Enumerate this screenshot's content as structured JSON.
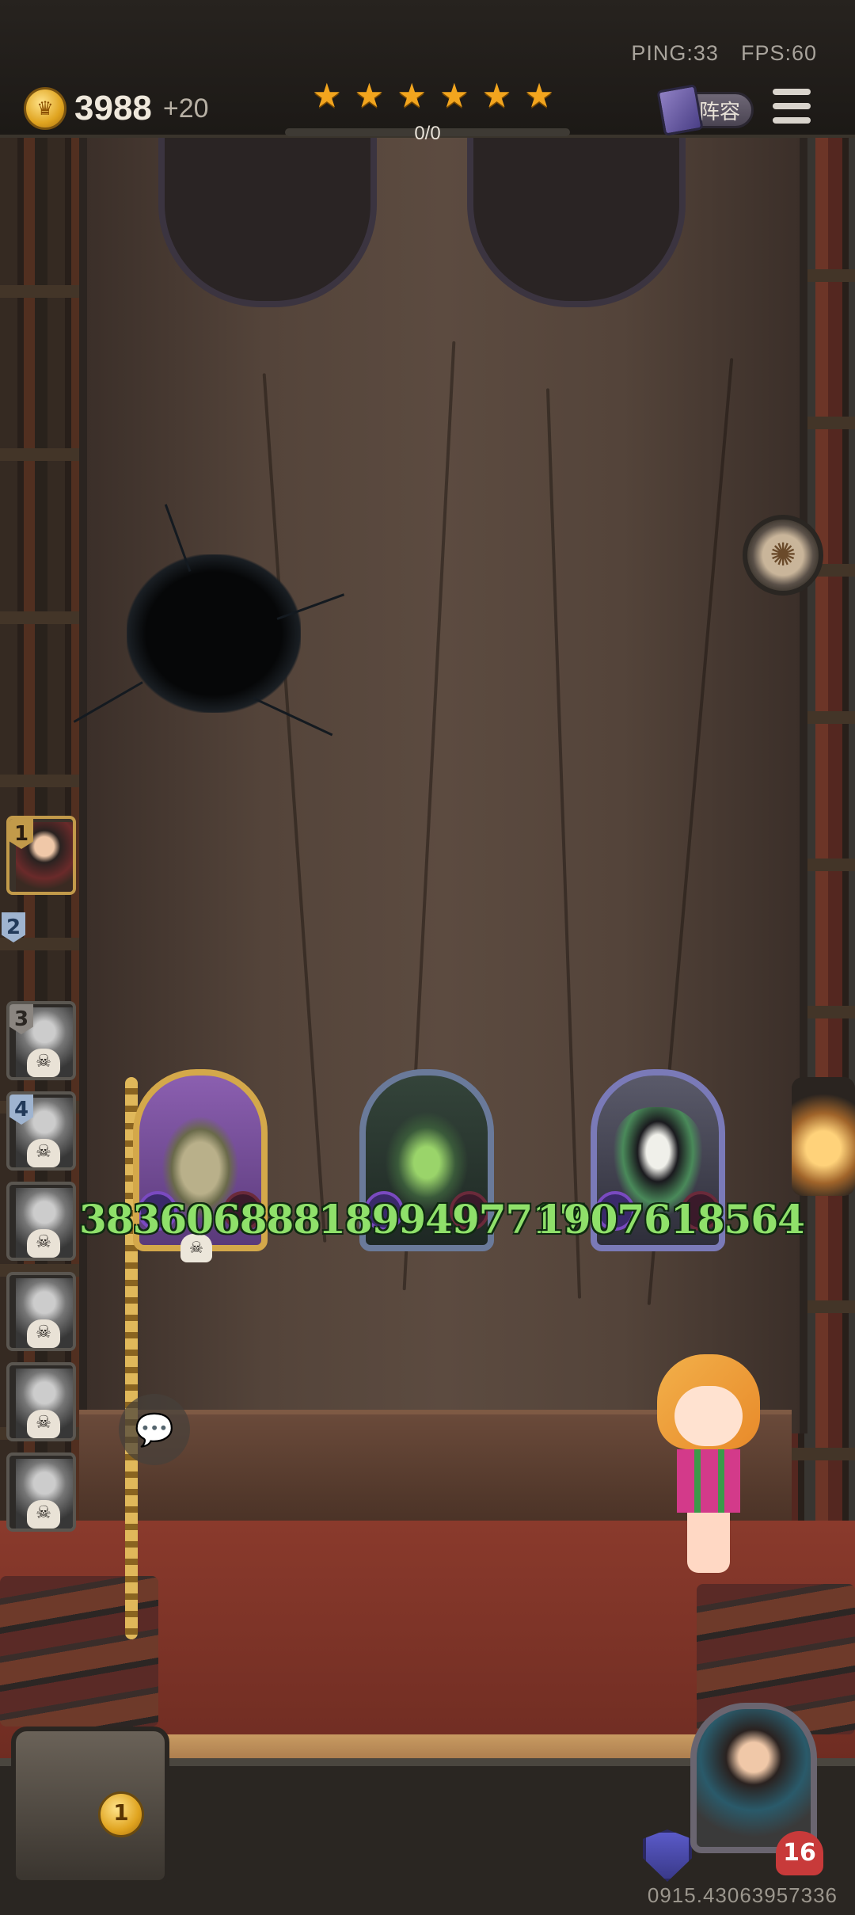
{
  "hud": {
    "ping_label": "PING:33",
    "fps_label": "FPS:60",
    "gold": "3988",
    "gold_income": "+20",
    "stars": [
      "★",
      "★",
      "★",
      "★",
      "★",
      "★"
    ],
    "progress_text": "0/0",
    "progress_fraction": 0,
    "lineup_label": "阵容"
  },
  "bench": [
    {
      "num": "1",
      "style": "active"
    },
    {
      "num": "2",
      "style": "blue-empty"
    },
    {
      "num": "3",
      "style": "dead"
    },
    {
      "num": "4",
      "style": "dead"
    },
    {
      "num": "",
      "style": "dead"
    },
    {
      "num": "",
      "style": "dead"
    },
    {
      "num": "",
      "style": "dead"
    },
    {
      "num": "",
      "style": "dead"
    }
  ],
  "battle": {
    "damage_numbers": [
      "383606888",
      "1899497717",
      "1907618564"
    ]
  },
  "bottom": {
    "chest_count": "1",
    "health": "16",
    "version": "0915.43063957336"
  },
  "icons": {
    "skull": "☠",
    "chat": "💬",
    "fan": "✺"
  },
  "colors": {
    "damage_text": "#8fe06a",
    "star": "#f2a51e",
    "gold_trim": "#d4a84a"
  }
}
